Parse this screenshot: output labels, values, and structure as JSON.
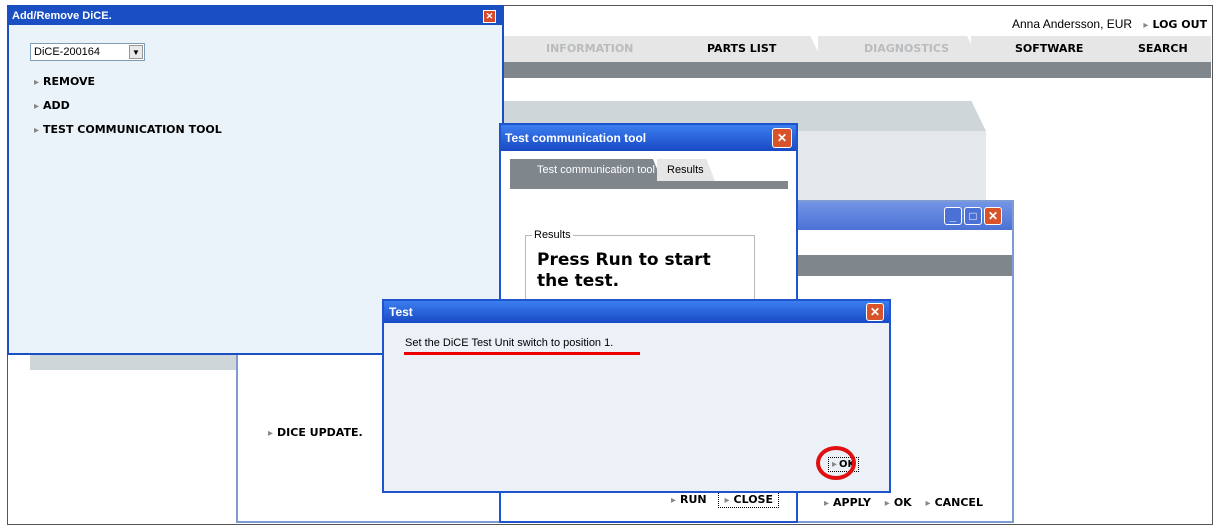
{
  "header": {
    "user": "Anna Andersson, EUR",
    "logout": "LOG OUT",
    "tabs": [
      {
        "label": "INFORMATION",
        "enabled": false
      },
      {
        "label": "PARTS LIST",
        "enabled": true
      },
      {
        "label": "DIAGNOSTICS",
        "enabled": false
      },
      {
        "label": "SOFTWARE",
        "enabled": true
      },
      {
        "label": "SEARCH",
        "enabled": true
      }
    ]
  },
  "back_window": {
    "dice_update": "DICE UPDATE.",
    "apply": "APPLY",
    "ok": "OK",
    "cancel": "CANCEL"
  },
  "add_remove": {
    "title": "Add/Remove DiCE.",
    "selected_dice": "DiCE-200164",
    "items": [
      "REMOVE",
      "ADD",
      "TEST COMMUNICATION TOOL"
    ]
  },
  "tct": {
    "title": "Test communication tool",
    "tabs": [
      "Test communication tool",
      "Results"
    ],
    "results_legend": "Results",
    "press_run": "Press Run to start the test.",
    "run": "RUN",
    "close": "CLOSE"
  },
  "test_dialog": {
    "title": "Test",
    "message": "Set the DiCE Test Unit switch to position 1.",
    "ok": "OK"
  },
  "colors": {
    "title_blue": "#1a4fc4",
    "annotation_red": "#e00000",
    "tab_gray": "#7f868c"
  }
}
